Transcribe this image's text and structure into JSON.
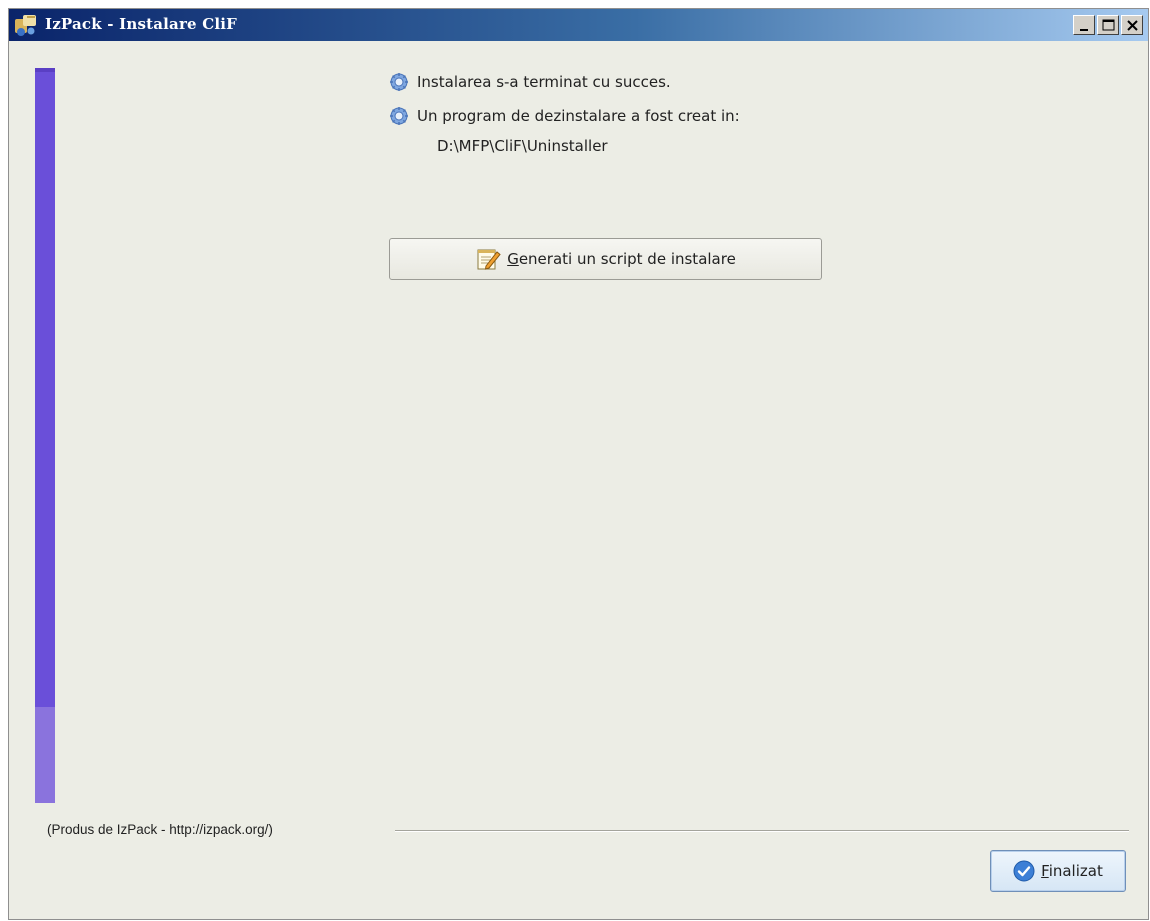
{
  "window": {
    "title": "IzPack - Instalare CliF"
  },
  "messages": {
    "success": "Instalarea s-a terminat cu succes.",
    "uninstaller_created": "Un program de dezinstalare a fost creat in:",
    "uninstaller_path": "D:\\MFP\\CliF\\Uninstaller"
  },
  "actions": {
    "generate_script_label": "Generati un script de instalare",
    "finish_label": "Finalizat"
  },
  "footer": {
    "credit": "(Produs de IzPack - http://izpack.org/)"
  },
  "progress": {
    "completed_fraction": 0.87
  },
  "icons": {
    "app": "izpack-app-icon",
    "info": "gear-info-icon",
    "script": "notepad-pencil-icon",
    "finish": "blue-check-icon"
  },
  "colors": {
    "progress_fill": "#6a4fd9",
    "progress_rest": "#8a73dd",
    "background": "#ecede5"
  }
}
